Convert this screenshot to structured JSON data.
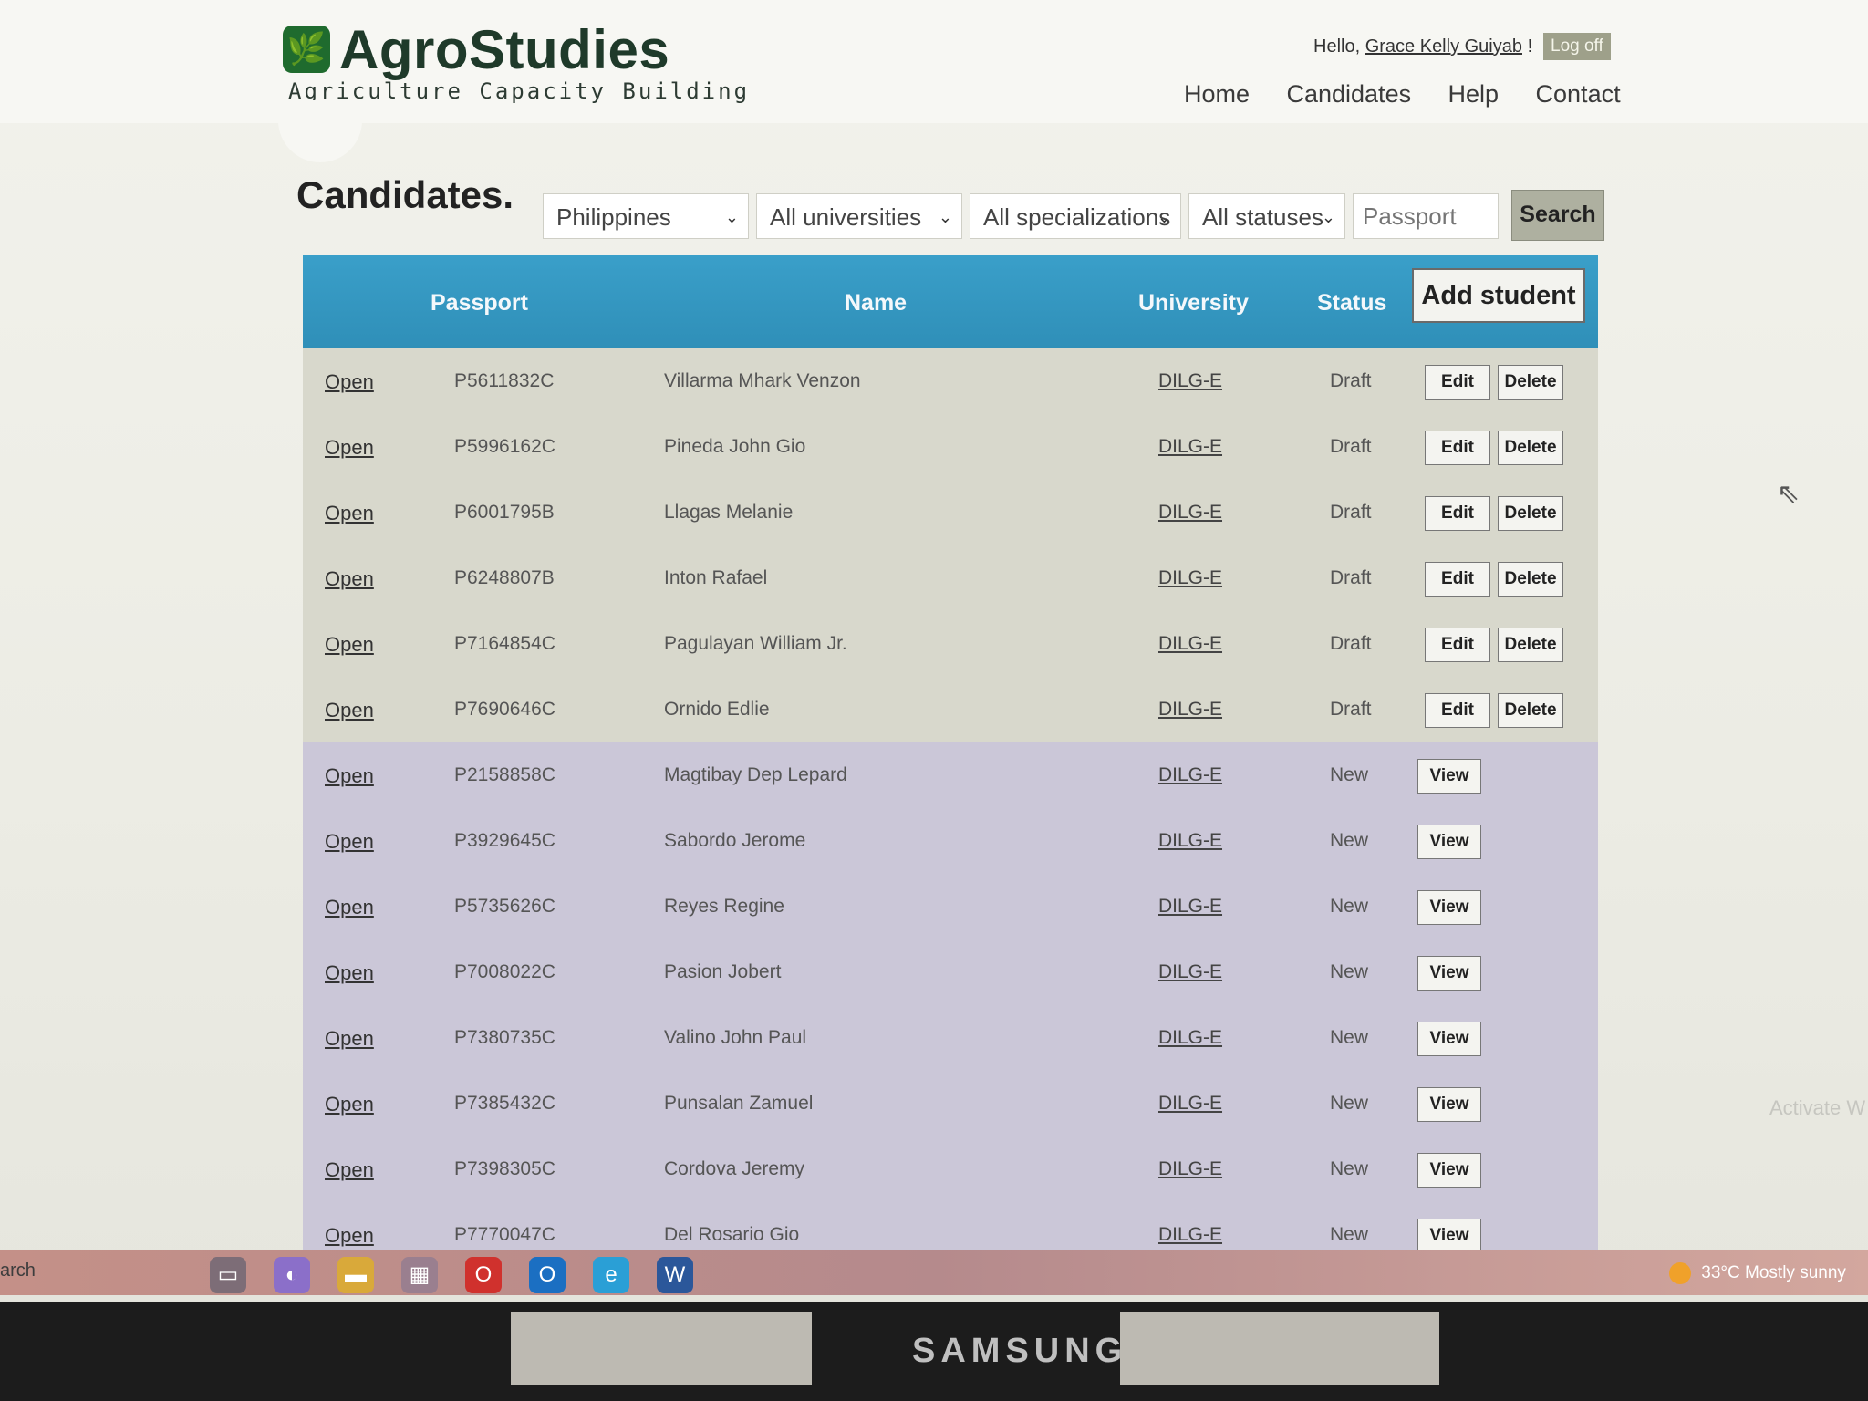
{
  "header": {
    "logo_mark": "🌿",
    "logo_title": "AgroStudies",
    "logo_tagline": "Agriculture Capacity Building",
    "greeting_prefix": "Hello,",
    "user_name": "Grace Kelly Guiyab",
    "greeting_suffix": "!",
    "logoff_label": "Log off",
    "nav": [
      "Home",
      "Candidates",
      "Help",
      "Contact"
    ]
  },
  "page": {
    "title": "Candidates."
  },
  "filters": {
    "country": "Philippines",
    "university": "All universities",
    "specialization": "All specializations",
    "status": "All statuses",
    "passport_placeholder": "Passport",
    "search_label": "Search"
  },
  "table": {
    "columns": {
      "passport": "Passport",
      "name": "Name",
      "university": "University",
      "status": "Status"
    },
    "add_student_label": "Add student",
    "open_label": "Open",
    "edit_label": "Edit",
    "delete_label": "Delete",
    "view_label": "View",
    "rows": [
      {
        "passport": "P5611832C",
        "name": "Villarma Mhark Venzon",
        "university": "DILG-E",
        "status": "Draft"
      },
      {
        "passport": "P5996162C",
        "name": "Pineda John Gio",
        "university": "DILG-E",
        "status": "Draft"
      },
      {
        "passport": "P6001795B",
        "name": "Llagas Melanie",
        "university": "DILG-E",
        "status": "Draft"
      },
      {
        "passport": "P6248807B",
        "name": "Inton Rafael",
        "university": "DILG-E",
        "status": "Draft"
      },
      {
        "passport": "P7164854C",
        "name": "Pagulayan William Jr.",
        "university": "DILG-E",
        "status": "Draft"
      },
      {
        "passport": "P7690646C",
        "name": "Ornido Edlie",
        "university": "DILG-E",
        "status": "Draft"
      },
      {
        "passport": "P2158858C",
        "name": "Magtibay Dep Lepard",
        "university": "DILG-E",
        "status": "New"
      },
      {
        "passport": "P3929645C",
        "name": "Sabordo Jerome",
        "university": "DILG-E",
        "status": "New"
      },
      {
        "passport": "P5735626C",
        "name": "Reyes Regine",
        "university": "DILG-E",
        "status": "New"
      },
      {
        "passport": "P7008022C",
        "name": "Pasion Jobert",
        "university": "DILG-E",
        "status": "New"
      },
      {
        "passport": "P7380735C",
        "name": "Valino John Paul",
        "university": "DILG-E",
        "status": "New"
      },
      {
        "passport": "P7385432C",
        "name": "Punsalan Zamuel",
        "university": "DILG-E",
        "status": "New"
      },
      {
        "passport": "P7398305C",
        "name": "Cordova Jeremy",
        "university": "DILG-E",
        "status": "New"
      },
      {
        "passport": "P7770047C",
        "name": "Del Rosario Gio",
        "university": "DILG-E",
        "status": "New"
      }
    ]
  },
  "overlay": {
    "activate_text": "Activate W"
  },
  "taskbar": {
    "search_text": "arch",
    "icons": [
      "task-view-icon",
      "copilot-icon",
      "file-explorer-icon",
      "store-icon",
      "opera-icon",
      "outlook-icon",
      "edge-icon",
      "word-icon"
    ],
    "weather_temp": "33°C",
    "weather_desc": "Mostly sunny"
  },
  "monitor": {
    "brand": "SAMSUNG"
  },
  "colors": {
    "table_header": "#2f8fb8",
    "draft_row": "#d8d8cc",
    "new_row": "#cbc7d8",
    "logo_green": "#1f6b2e"
  }
}
